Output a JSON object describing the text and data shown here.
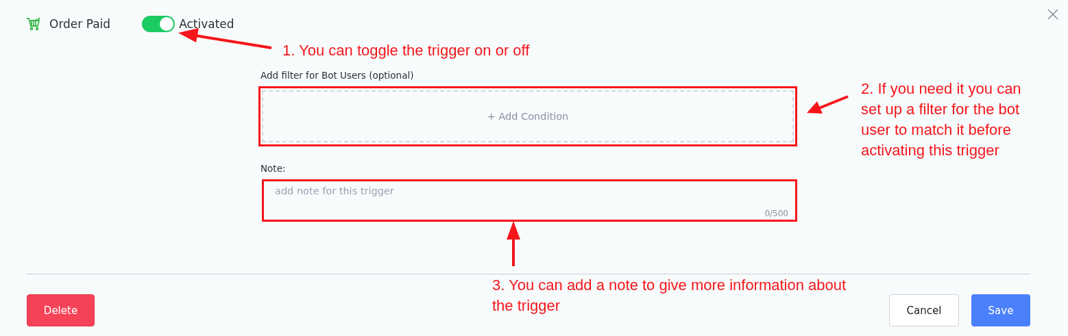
{
  "header": {
    "title": "Order Paid",
    "toggle": {
      "on": true,
      "label": "Activated"
    }
  },
  "filter": {
    "label": "Add filter for Bot Users (optional)",
    "add_button": "+ Add Condition"
  },
  "note": {
    "label": "Note:",
    "placeholder": "add note for this trigger",
    "counter": "0/500"
  },
  "buttons": [
    {
      "kind": "danger",
      "label": "Delete"
    },
    {
      "kind": "secondary",
      "label": "Cancel"
    },
    {
      "kind": "primary",
      "label": "Save"
    }
  ],
  "annotations": [
    {
      "text": "1. You can toggle the trigger on or off"
    },
    {
      "text": "2. If you need it you can set up a filter for the bot user to match it before activating this trigger"
    },
    {
      "text": "3. You can add a note to give more information about the trigger"
    }
  ]
}
